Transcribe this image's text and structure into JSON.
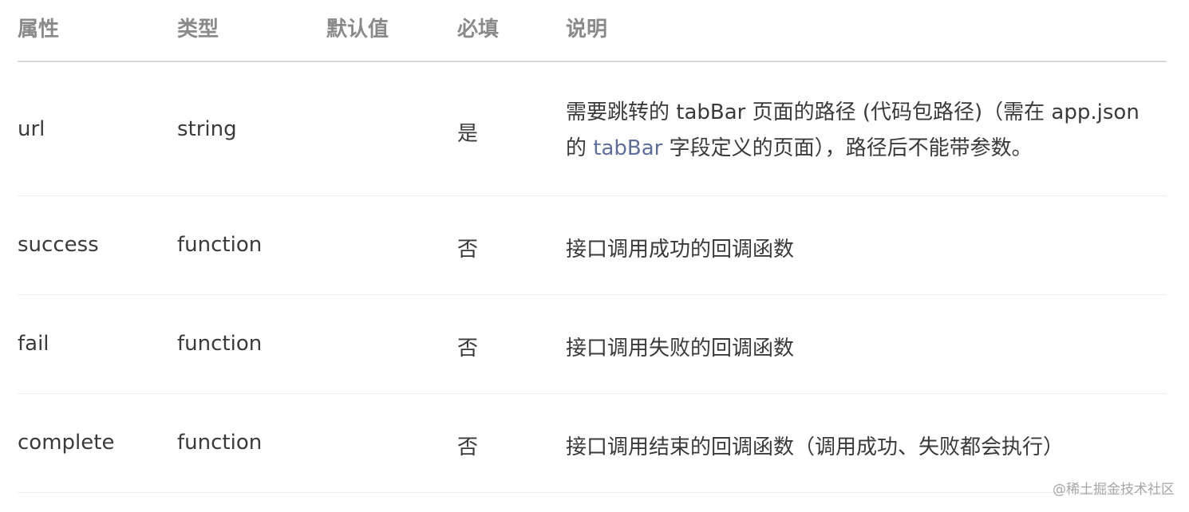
{
  "headers": {
    "attribute": "属性",
    "type": "类型",
    "default": "默认值",
    "required": "必填",
    "description": "说明"
  },
  "rows": [
    {
      "attribute": "url",
      "type": "string",
      "default": "",
      "required": "是",
      "desc_line1": "需要跳转的 tabBar 页面的路径 (代码包路径)（需在 app.json",
      "desc_line2_prefix": "的 ",
      "desc_link": "tabBar",
      "desc_line2_suffix": " 字段定义的页面），路径后不能带参数。"
    },
    {
      "attribute": "success",
      "type": "function",
      "default": "",
      "required": "否",
      "description": "接口调用成功的回调函数"
    },
    {
      "attribute": "fail",
      "type": "function",
      "default": "",
      "required": "否",
      "description": "接口调用失败的回调函数"
    },
    {
      "attribute": "complete",
      "type": "function",
      "default": "",
      "required": "否",
      "description": "接口调用结束的回调函数（调用成功、失败都会执行）"
    }
  ],
  "watermark": "@稀土掘金技术社区",
  "colors": {
    "header_text": "#8a8a8a",
    "body_text": "#3a3a3a",
    "link": "#5f6f9a",
    "header_border": "#d9d9d9",
    "row_border": "#ececec"
  }
}
